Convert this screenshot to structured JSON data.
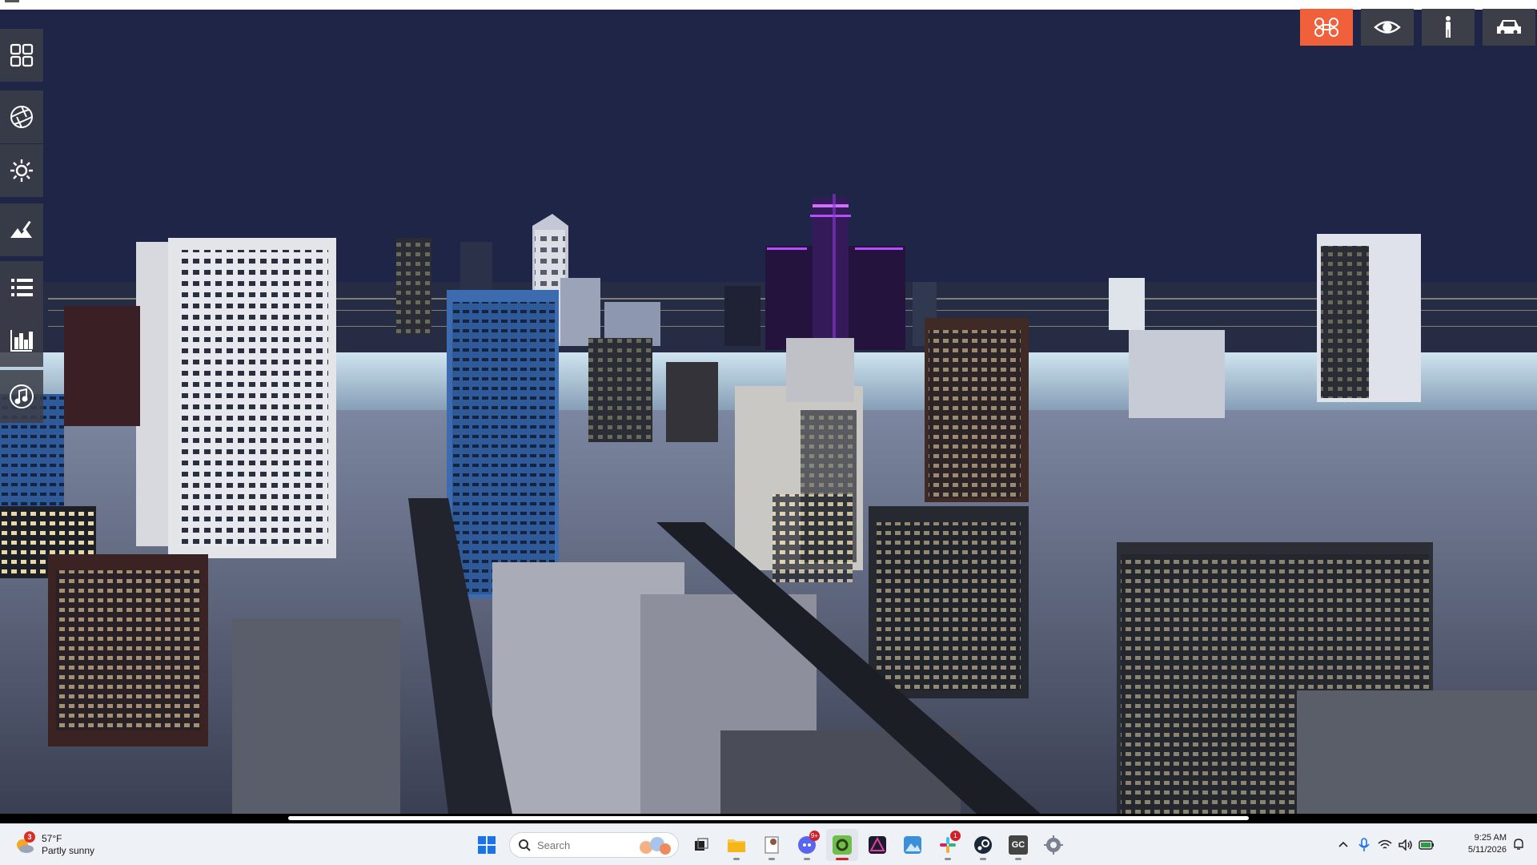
{
  "colors": {
    "accent": "#f0603a",
    "toolbar_bg": "#3d3f48",
    "sky": "#1b2140",
    "landmark_glow": "#b040ff"
  },
  "left_toolbar": [
    {
      "name": "grid-icon"
    },
    {
      "name": "aperture-icon"
    },
    {
      "name": "sun-icon"
    },
    {
      "name": "terrain-brush-icon"
    },
    {
      "name": "list-icon"
    },
    {
      "name": "bar-chart-icon"
    },
    {
      "name": "music-icon"
    }
  ],
  "top_modes": [
    {
      "name": "drone-mode",
      "icon": "drone-icon",
      "active": true
    },
    {
      "name": "eye-mode",
      "icon": "eye-icon",
      "active": false
    },
    {
      "name": "pedestrian-mode",
      "icon": "person-icon",
      "active": false
    },
    {
      "name": "car-mode",
      "icon": "car-icon",
      "active": false
    }
  ],
  "taskbar": {
    "weather": {
      "temp": "57°F",
      "condition": "Partly sunny",
      "badge": "3"
    },
    "search": {
      "placeholder": "Search"
    },
    "apps": [
      {
        "name": "windows-start",
        "icon": "windows-icon"
      },
      {
        "name": "task-view",
        "icon": "task-view-icon"
      },
      {
        "name": "file-explorer",
        "icon": "folder-icon"
      },
      {
        "name": "notepad-app",
        "icon": "notepad-icon"
      },
      {
        "name": "discord-app",
        "icon": "discord-icon",
        "badge": "9+"
      },
      {
        "name": "active-app",
        "icon": "ring-icon",
        "active": true
      },
      {
        "name": "affinity-app",
        "icon": "affinity-icon"
      },
      {
        "name": "photos-app",
        "icon": "photos-icon"
      },
      {
        "name": "slack-app",
        "icon": "slack-icon",
        "badge": "1"
      },
      {
        "name": "steam-app",
        "icon": "steam-icon"
      },
      {
        "name": "gc-app",
        "icon": "gc-icon",
        "label": "GC"
      },
      {
        "name": "settings-app",
        "icon": "gear-icon"
      }
    ],
    "clock": {
      "time": "9:25 AM",
      "date": "5/11/2026"
    }
  }
}
